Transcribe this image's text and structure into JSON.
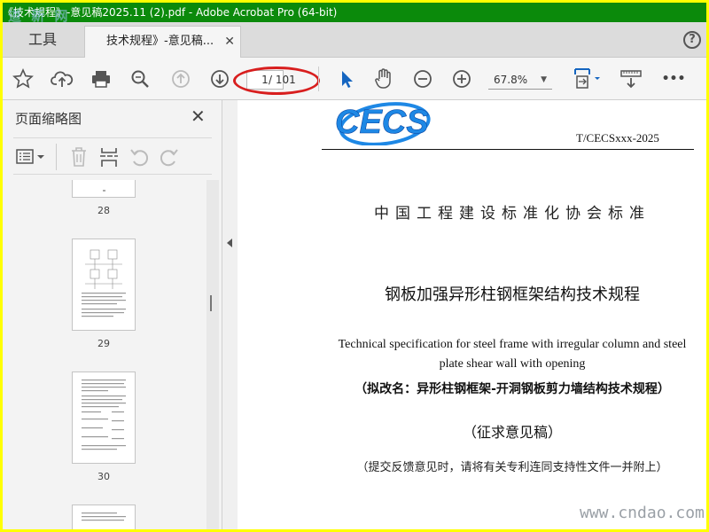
{
  "window": {
    "title": "《技术规程》-意见稿2025.11 (2).pdf - Adobe Acrobat Pro (64-bit)",
    "title_colors": {
      "bar": "#0b8a0b",
      "text": "#ffffff"
    }
  },
  "watermarks": {
    "top_left": "道 新 网",
    "bottom_right": "www.cndao.com"
  },
  "tabs": {
    "tools": "工具",
    "document": "技术规程》-意见稿...",
    "close": "✕",
    "help": "?"
  },
  "toolbar": {
    "page_current": "1",
    "page_total": "/ 101",
    "zoom": "67.8%",
    "zoom_caret": "▼",
    "more": "•••",
    "icons": [
      "star-icon",
      "cloud-upload-icon",
      "print-icon",
      "search-zoom-icon",
      "prev-page-icon",
      "next-page-icon",
      "select-arrow-icon",
      "hand-icon",
      "zoom-out-icon",
      "zoom-in-icon",
      "fit-page-icon",
      "scroll-mode-icon",
      "more-icon"
    ],
    "highlight_color": "#d81e1e"
  },
  "sidebar": {
    "title": "页面缩略图",
    "close": "✕",
    "thumbnails": [
      {
        "page": "28"
      },
      {
        "page": "29"
      },
      {
        "page": "30"
      },
      {
        "page": ""
      }
    ]
  },
  "document": {
    "logo": "CECS",
    "standard_code": "T/CECSxxx-2025",
    "organization": "中国工程建设标准化协会标准",
    "title_cn": "钢板加强异形柱钢框架结构技术规程",
    "title_en": "Technical specification for steel frame with irregular column and steel plate shear wall with opening",
    "alt_name": "（拟改名：异形柱钢框架-开洞钢板剪力墙结构技术规程）",
    "draft_label": "（征求意见稿）",
    "submission_note": "（提交反馈意见时，请将有关专利连同支持性文件一并附上）",
    "logo_color": "#1e88e5"
  }
}
